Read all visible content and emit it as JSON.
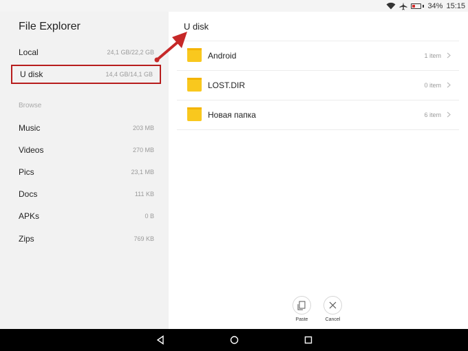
{
  "status_bar": {
    "battery_percent": "34%",
    "time": "15:15",
    "battery_level": 0.34,
    "battery_color": "#d32f2f"
  },
  "sidebar": {
    "title": "File Explorer",
    "storage": [
      {
        "label": "Local",
        "size": "24,1 GB/22,2 GB"
      },
      {
        "label": "U disk",
        "size": "14,4 GB/14,1 GB"
      }
    ],
    "browse_label": "Browse",
    "categories": [
      {
        "label": "Music",
        "size": "203 MB"
      },
      {
        "label": "Videos",
        "size": "270 MB"
      },
      {
        "label": "Pics",
        "size": "23,1 MB"
      },
      {
        "label": "Docs",
        "size": "111 KB"
      },
      {
        "label": "APKs",
        "size": "0 B"
      },
      {
        "label": "Zips",
        "size": "769 KB"
      }
    ]
  },
  "main": {
    "breadcrumb": "U disk",
    "files": [
      {
        "name": "Android",
        "count": "1 item"
      },
      {
        "name": "LOST.DIR",
        "count": "0 item"
      },
      {
        "name": "Новая папка",
        "count": "6 item"
      }
    ],
    "actions": [
      {
        "label": "Paste",
        "icon": "paste-icon"
      },
      {
        "label": "Cancel",
        "icon": "close-icon"
      }
    ]
  },
  "colors": {
    "folder": "#f9c81e",
    "highlight_border": "#b71c1c",
    "annotation_arrow": "#c62828"
  }
}
